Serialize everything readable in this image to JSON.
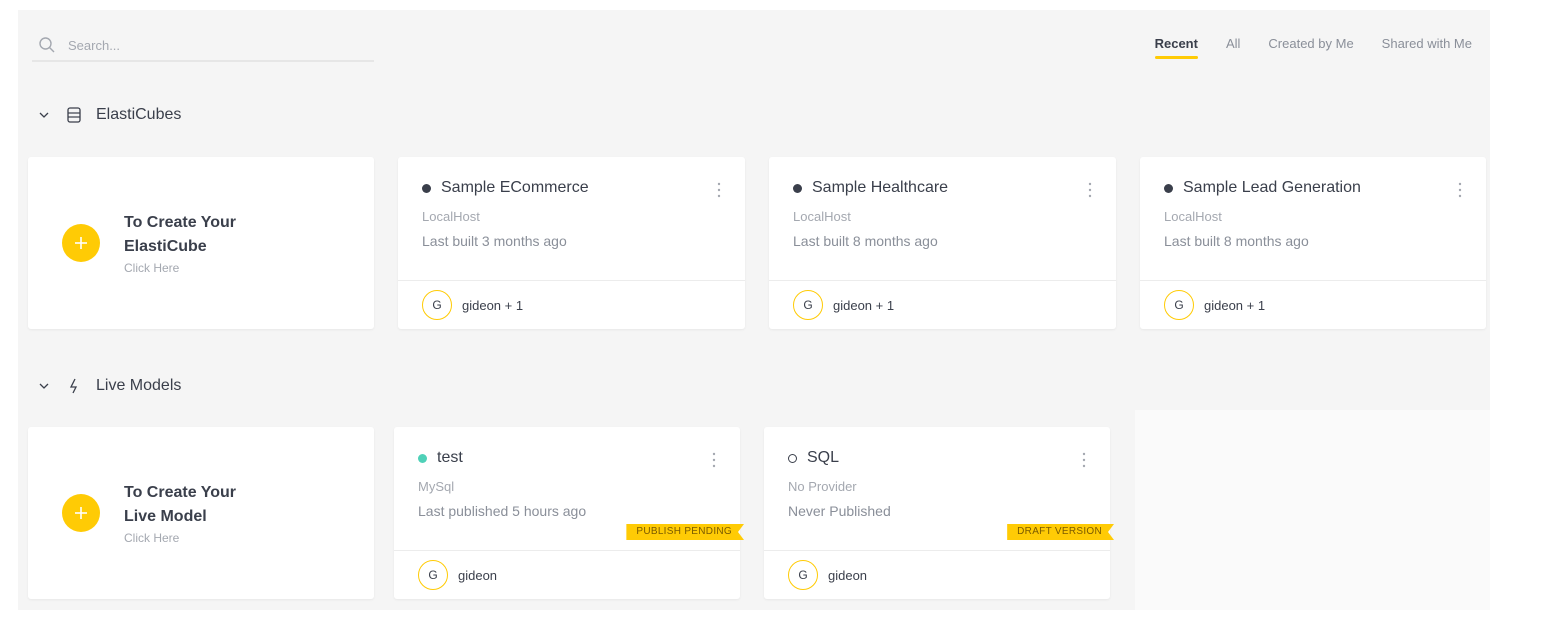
{
  "search": {
    "placeholder": "Search..."
  },
  "filters": [
    {
      "label": "Recent",
      "active": true
    },
    {
      "label": "All",
      "active": false
    },
    {
      "label": "Created by Me",
      "active": false
    },
    {
      "label": "Shared with Me",
      "active": false
    }
  ],
  "sections": {
    "elasticubes": {
      "title": "ElastiCubes",
      "icon": "database-icon",
      "create": {
        "title_line1": "To Create Your",
        "title_line2": "ElastiCube",
        "subtitle": "Click Here"
      },
      "items": [
        {
          "name": "Sample ECommerce",
          "provider": "LocalHost",
          "status": "Last built 3 months ago",
          "owner_initial": "G",
          "owner": "gideon + 1"
        },
        {
          "name": "Sample Healthcare",
          "provider": "LocalHost",
          "status": "Last built 8 months ago",
          "owner_initial": "G",
          "owner": "gideon + 1"
        },
        {
          "name": "Sample Lead Generation",
          "provider": "LocalHost",
          "status": "Last built 8 months ago",
          "owner_initial": "G",
          "owner": "gideon + 1"
        }
      ]
    },
    "live_models": {
      "title": "Live Models",
      "icon": "lightning-icon",
      "create": {
        "title_line1": "To Create Your",
        "title_line2": "Live Model",
        "subtitle": "Click Here"
      },
      "items": [
        {
          "name": "test",
          "provider": "MySql",
          "status": "Last published 5 hours ago",
          "owner_initial": "G",
          "owner": "gideon",
          "badge": "PUBLISH PENDING"
        },
        {
          "name": "SQL",
          "provider": "No Provider",
          "status": "Never Published",
          "owner_initial": "G",
          "owner": "gideon",
          "badge": "DRAFT VERSION"
        }
      ]
    }
  },
  "colors": {
    "accent": "#ffcb05",
    "text": "#3a3f4b",
    "live_dot": "#4fd1b8",
    "background": "#f5f5f5"
  }
}
